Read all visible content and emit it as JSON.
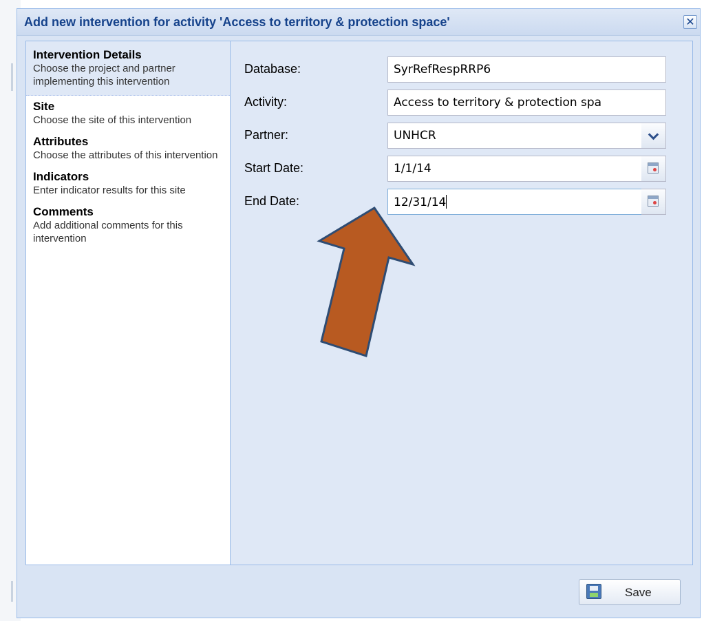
{
  "dialog": {
    "title": "Add new intervention for activity 'Access to territory & protection space'",
    "close_glyph": "✕"
  },
  "nav": {
    "items": [
      {
        "title": "Intervention Details",
        "desc": "Choose the project and partner implementing this intervention",
        "selected": true
      },
      {
        "title": "Site",
        "desc": "Choose the site of this intervention"
      },
      {
        "title": "Attributes",
        "desc": "Choose the attributes of this intervention"
      },
      {
        "title": "Indicators",
        "desc": "Enter indicator results for this site"
      },
      {
        "title": "Comments",
        "desc": "Add additional comments for this intervention"
      }
    ]
  },
  "form": {
    "database": {
      "label": "Database:",
      "value": "SyrRefRespRRP6"
    },
    "activity": {
      "label": "Activity:",
      "value": "Access to territory & protection spa"
    },
    "partner": {
      "label": "Partner:",
      "value": "UNHCR"
    },
    "start_date": {
      "label": "Start Date:",
      "value": "1/1/14"
    },
    "end_date": {
      "label": "End Date:",
      "value": "12/31/14"
    }
  },
  "footer": {
    "save_label": "Save"
  },
  "colors": {
    "title_text": "#15428b",
    "panel_bg": "#dfe8f6",
    "arrow_fill": "#b85a21",
    "arrow_stroke": "#2e4c73"
  },
  "icons": {
    "close": "close-icon",
    "dropdown": "chevron-down-icon",
    "calendar": "calendar-icon",
    "save": "disk-icon",
    "annotation": "arrow-up-icon"
  }
}
